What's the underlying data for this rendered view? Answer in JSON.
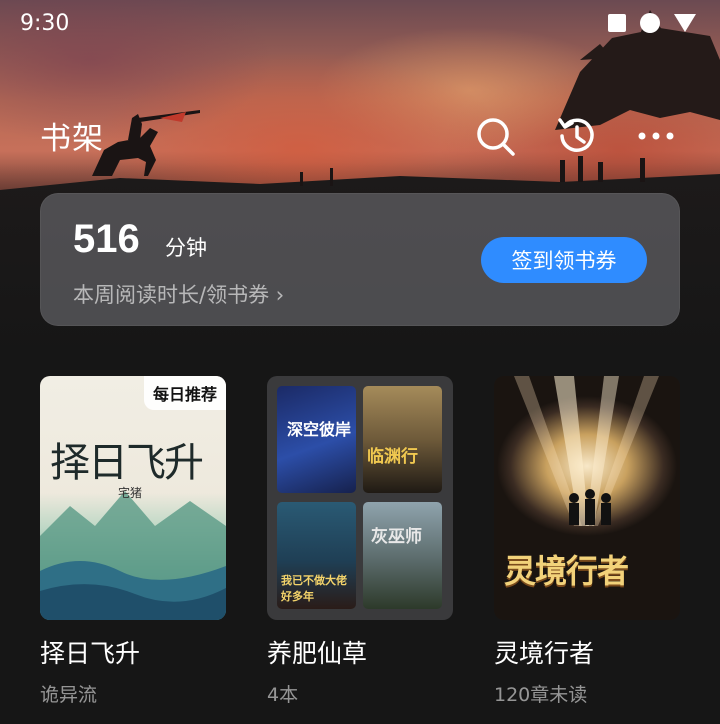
{
  "status_bar": {
    "time": "9:30"
  },
  "header": {
    "title": "书架"
  },
  "reading_card": {
    "minutes": "516",
    "unit": "分钟",
    "subtitle": "本周阅读时长/领书券 ›",
    "sign_button": "签到领书券"
  },
  "books": [
    {
      "title": "择日飞升",
      "subtitle": "诡异流",
      "badge": "每日推荐",
      "cover_text": "择日飞升",
      "cover_author": "宅猪"
    },
    {
      "title": "养肥仙草",
      "subtitle": "4本",
      "covers": [
        "深空彼岸",
        "临渊行",
        "我已不做大佬好多年",
        "灰巫师"
      ]
    },
    {
      "title": "灵境行者",
      "subtitle": "120章未读",
      "cover_text": "灵境行者"
    }
  ],
  "colors": {
    "accent": "#2f8cff",
    "background": "#161616"
  },
  "icons": [
    "search-icon",
    "history-icon",
    "more-icon"
  ]
}
